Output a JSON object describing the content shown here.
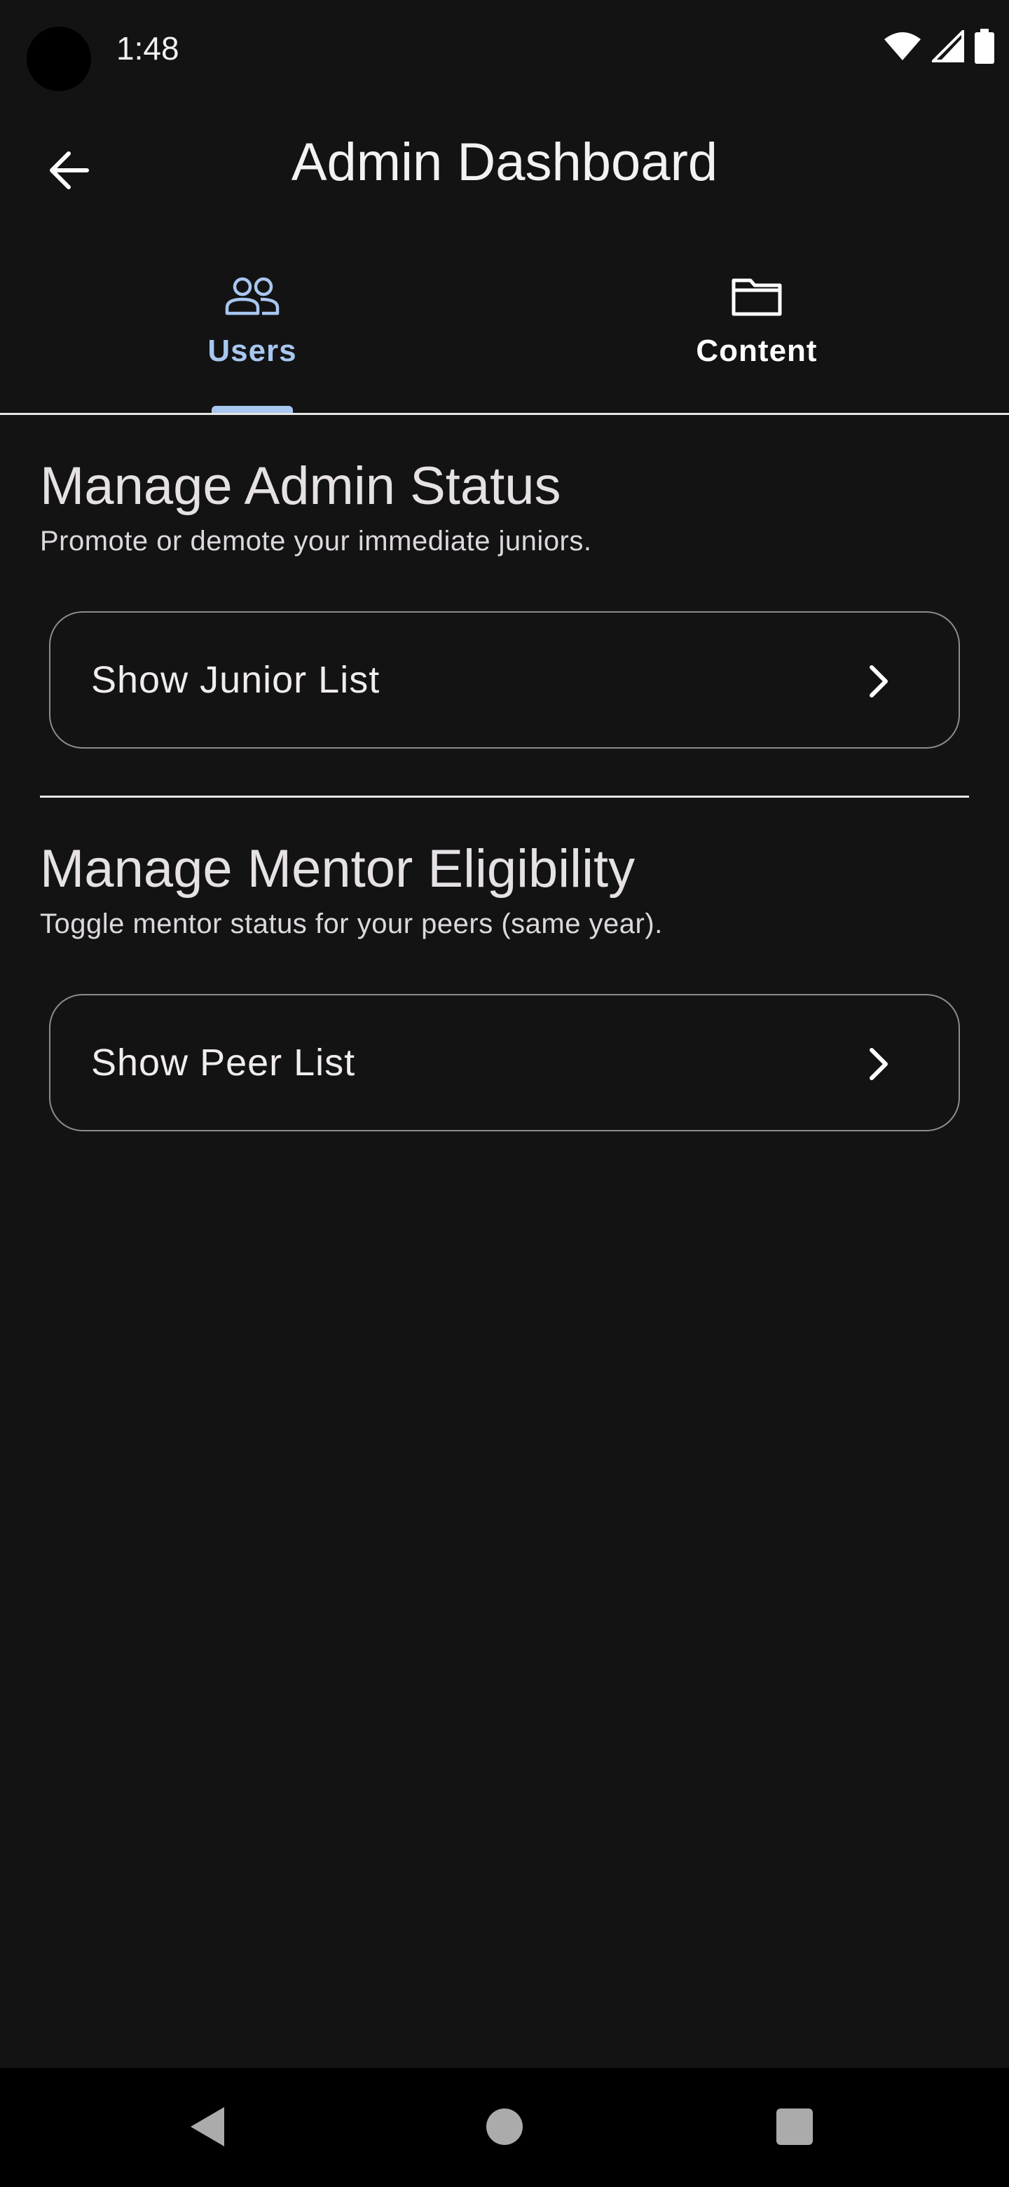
{
  "status_bar": {
    "time": "1:48",
    "icons": [
      "wifi-icon",
      "cell-signal-icon",
      "battery-icon"
    ]
  },
  "app_bar": {
    "title": "Admin Dashboard",
    "back_icon": "arrow-back-icon"
  },
  "tabs": [
    {
      "label": "Users",
      "icon": "people-icon",
      "selected": true
    },
    {
      "label": "Content",
      "icon": "folder-icon",
      "selected": false
    }
  ],
  "sections": [
    {
      "title": "Manage Admin Status",
      "subtitle": "Promote or demote your immediate juniors.",
      "button_label": "Show Junior List"
    },
    {
      "title": "Manage Mentor Eligibility",
      "subtitle": "Toggle mentor status for your peers (same year).",
      "button_label": "Show Peer List"
    }
  ],
  "nav_bar": {
    "icons": [
      "nav-back-icon",
      "nav-home-icon",
      "nav-recents-icon"
    ]
  },
  "colors": {
    "background": "#131314",
    "accent": "#a8c7f0",
    "divider": "#e6e6e6",
    "outline": "#8d8a90"
  }
}
